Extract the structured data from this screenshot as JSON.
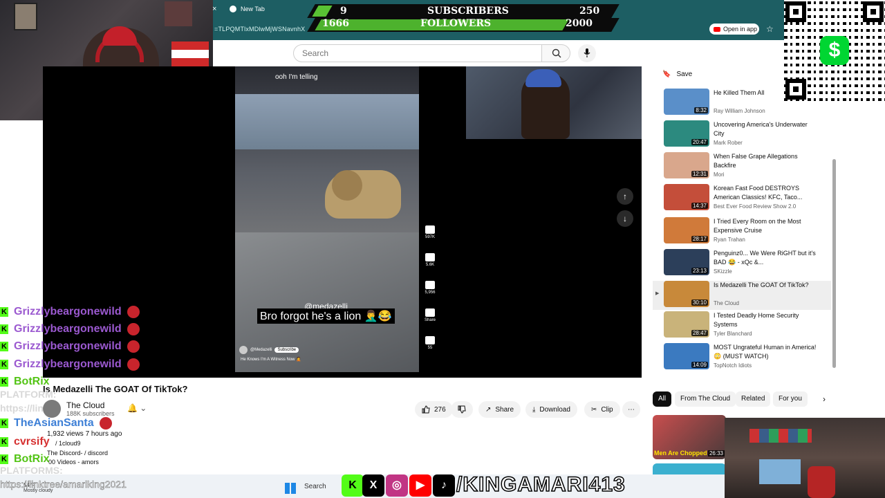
{
  "browser": {
    "tab_close": "×",
    "tab_label": "New Tab",
    "url_fragment": "=TLPQMTlxMDlwMjWSNavnhX",
    "open_in_app": "Open in app",
    "bookmark_icon": "star-icon"
  },
  "sub_banner": {
    "subs_current": "9",
    "subs_label": "SUBSCRIBERS",
    "subs_goal": "250",
    "subs_progress": 0.036,
    "followers_current": "1666",
    "followers_label": "FOLLOWERS",
    "followers_goal": "2000",
    "followers_progress": 0.833
  },
  "cashapp": {
    "symbol": "$"
  },
  "youtube": {
    "search_placeholder": "Search",
    "search_icon": "search-icon",
    "mic_icon": "mic-icon"
  },
  "short": {
    "overlay_text": "ooh I'm telling",
    "handle": "@medazelli",
    "caption": "Bro forgot he's a lion 🤦‍♂️😂",
    "channel": "@Medazelli",
    "subscribe": "Subscribe",
    "description": "He Knows I'm A Witness Now 🤦",
    "likes": "597K",
    "dislike": "5.6K",
    "comments": "5,956",
    "share": "Share",
    "remix": "55"
  },
  "nav": {
    "up": "↑",
    "down": "↓"
  },
  "video": {
    "title": "Is Medazelli The GOAT Of TikTok?",
    "channel": "The Cloud",
    "subscribers": "188K subscribers",
    "likes": "276",
    "share": "Share",
    "download": "Download",
    "clip": "Clip",
    "more": "⋯",
    "views_line": "1,932 views  7 hours ago",
    "link_line1": "/ 1cloud9",
    "link_line2": "The Discord-  / discord",
    "videos_line": "00 Videos - amors"
  },
  "sidebar": {
    "save": "Save",
    "recs": [
      {
        "title": "He Killed Them All",
        "channel": "Ray William Johnson",
        "duration": "8:32"
      },
      {
        "title": "Uncovering America's Underwater City",
        "channel": "Mark Rober",
        "duration": "20:47"
      },
      {
        "title": "When False Grape Allegations Backfire",
        "channel": "Mori",
        "duration": "12:31"
      },
      {
        "title": "Korean Fast Food DESTROYS American Classics! KFC, Taco...",
        "channel": "Best Ever Food Review Show 2.0",
        "duration": "14:37"
      },
      {
        "title": "I Tried Every Room on the Most Expensive Cruise",
        "channel": "Ryan Trahan",
        "duration": "28:17"
      },
      {
        "title": "Penguinz0... We Were RiGHT but it's BAD 😂 - xQc &...",
        "channel": "SKizzle",
        "duration": "23:13"
      },
      {
        "title": "Is Medazelli The GOAT Of TikTok?",
        "channel": "The Cloud",
        "duration": "30:10"
      },
      {
        "title": "I Tested Deadly Home Security Systems",
        "channel": "Tyler Blanchard",
        "duration": "28:47"
      },
      {
        "title": "MOST Ungrateful Human in America! 😳 (MUST WATCH)",
        "channel": "TopNotch Idiots",
        "duration": "14:09"
      }
    ],
    "chips": [
      "All",
      "From The Cloud",
      "Related",
      "For you"
    ],
    "chip_next": "›",
    "thumb_caption": "Men Are Chopped",
    "thumb_duration": "26:33"
  },
  "chat": {
    "messages": [
      {
        "user": "Grizzlybeargonewild",
        "color": "#9b59d0"
      },
      {
        "user": "Grizzlybeargonewild",
        "color": "#9b59d0"
      },
      {
        "user": "Grizzlybeargonewild",
        "color": "#9b59d0"
      },
      {
        "user": "Grizzlybeargonewild",
        "color": "#9b59d0"
      },
      {
        "user": "BotRix",
        "color": "#53c415"
      },
      {
        "user": "TheAsianSanta",
        "color": "#3d7fd6"
      },
      {
        "user": "cvrsify",
        "color": "#d63030"
      },
      {
        "user": "BotRix",
        "color": "#53c415"
      }
    ],
    "ghost1": "PLATFORM:",
    "ghost2": "https://lin",
    "ghost3": "PLATFORMS:"
  },
  "overlay": {
    "handle": "/KINGAMARI413",
    "linktree": "https://linktree/amariking2021",
    "socials": [
      "K",
      "X",
      "◎",
      "▶",
      "♪"
    ]
  },
  "taskbar": {
    "weather": "Mostly cloudy",
    "temp": "54°F",
    "search": "Search"
  }
}
